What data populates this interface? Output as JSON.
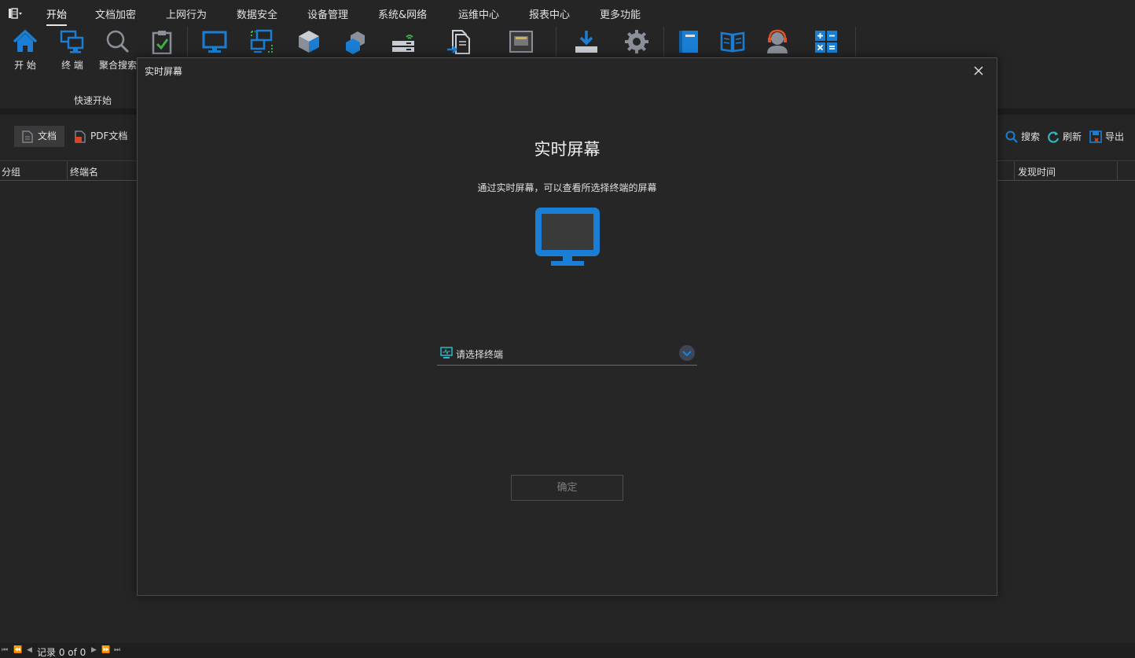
{
  "menu": {
    "items": [
      "开始",
      "文档加密",
      "上网行为",
      "数据安全",
      "设备管理",
      "系统&网络",
      "运维中心",
      "报表中心",
      "更多功能"
    ],
    "active_index": 0
  },
  "ribbon": {
    "start_label": "开 始",
    "terminal_label": "终 端",
    "search_label": "聚合搜索",
    "group_label": "快速开始"
  },
  "doc_tabs": {
    "doc_label": "文档",
    "pdf_label": "PDF文档"
  },
  "right_tools": {
    "search_label": "搜索",
    "refresh_label": "刷新",
    "export_label": "导出"
  },
  "grid": {
    "columns": [
      "分组",
      "终端名",
      "发现时间"
    ]
  },
  "status": {
    "record_text": "记录 0 of 0"
  },
  "dialog": {
    "title": "实时屏幕",
    "heading": "实时屏幕",
    "description": "通过实时屏幕，可以查看所选择终端的屏幕",
    "select_placeholder": "请选择终端",
    "ok_label": "确定"
  },
  "colors": {
    "accent_blue": "#1a7fd4",
    "background": "#252525",
    "dialog_bg": "#262626"
  }
}
